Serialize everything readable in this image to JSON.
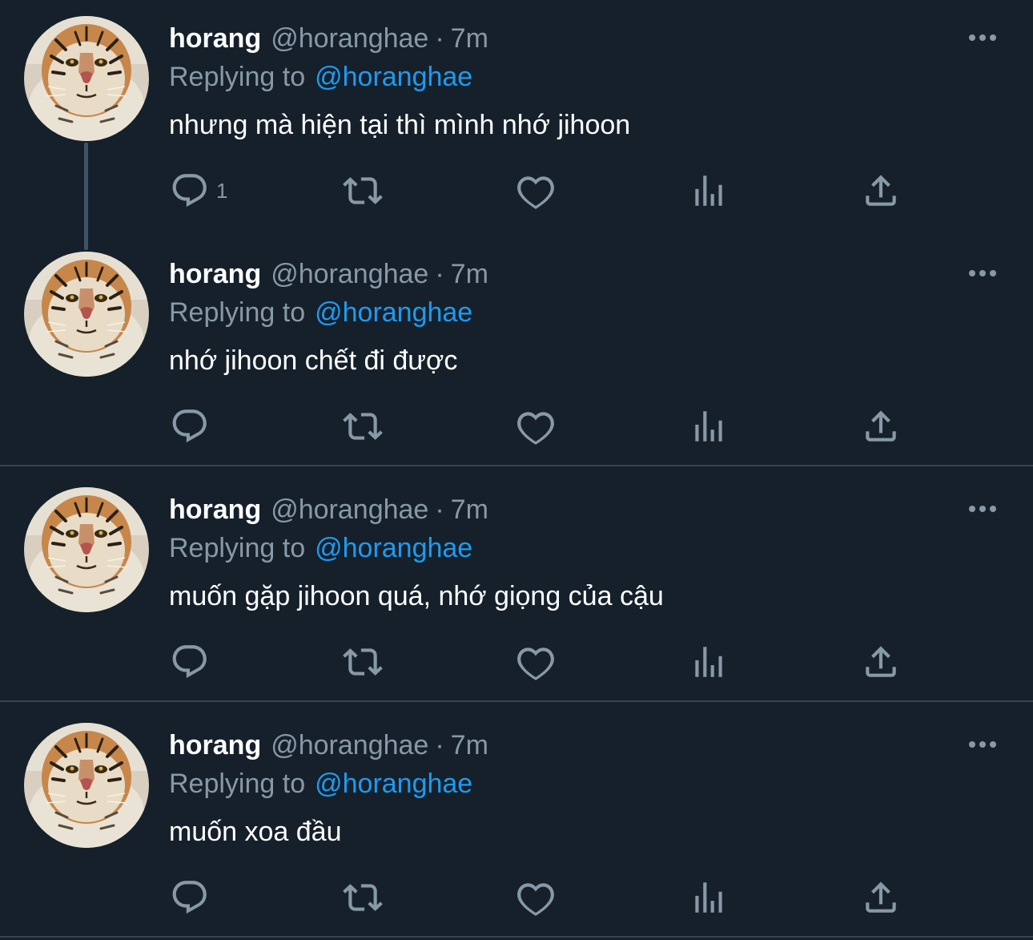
{
  "tweets": [
    {
      "name": "horang",
      "handle": "@horanghae",
      "separator": "·",
      "time": "7m",
      "replying_label": "Replying to",
      "replying_to": "@horanghae",
      "text": "nhưng mà hiện tại thì mình nhớ jihoon",
      "reply_count": "1"
    },
    {
      "name": "horang",
      "handle": "@horanghae",
      "separator": "·",
      "time": "7m",
      "replying_label": "Replying to",
      "replying_to": "@horanghae",
      "text": "nhớ jihoon chết đi được",
      "reply_count": ""
    },
    {
      "name": "horang",
      "handle": "@horanghae",
      "separator": "·",
      "time": "7m",
      "replying_label": "Replying to",
      "replying_to": "@horanghae",
      "text": "muốn gặp jihoon quá, nhớ giọng của cậu",
      "reply_count": ""
    },
    {
      "name": "horang",
      "handle": "@horanghae",
      "separator": "·",
      "time": "7m",
      "replying_label": "Replying to",
      "replying_to": "@horanghae",
      "text": "muốn xoa đầu",
      "reply_count": ""
    }
  ],
  "icons": {
    "reply": "reply-icon",
    "retweet": "retweet-icon",
    "like": "heart-icon",
    "views": "views-icon",
    "share": "share-icon",
    "more": "more-icon"
  },
  "colors": {
    "background": "#15202b",
    "text": "#ffffff",
    "secondary": "#8899a6",
    "link": "#1d9bf0",
    "divider": "#38444d"
  }
}
